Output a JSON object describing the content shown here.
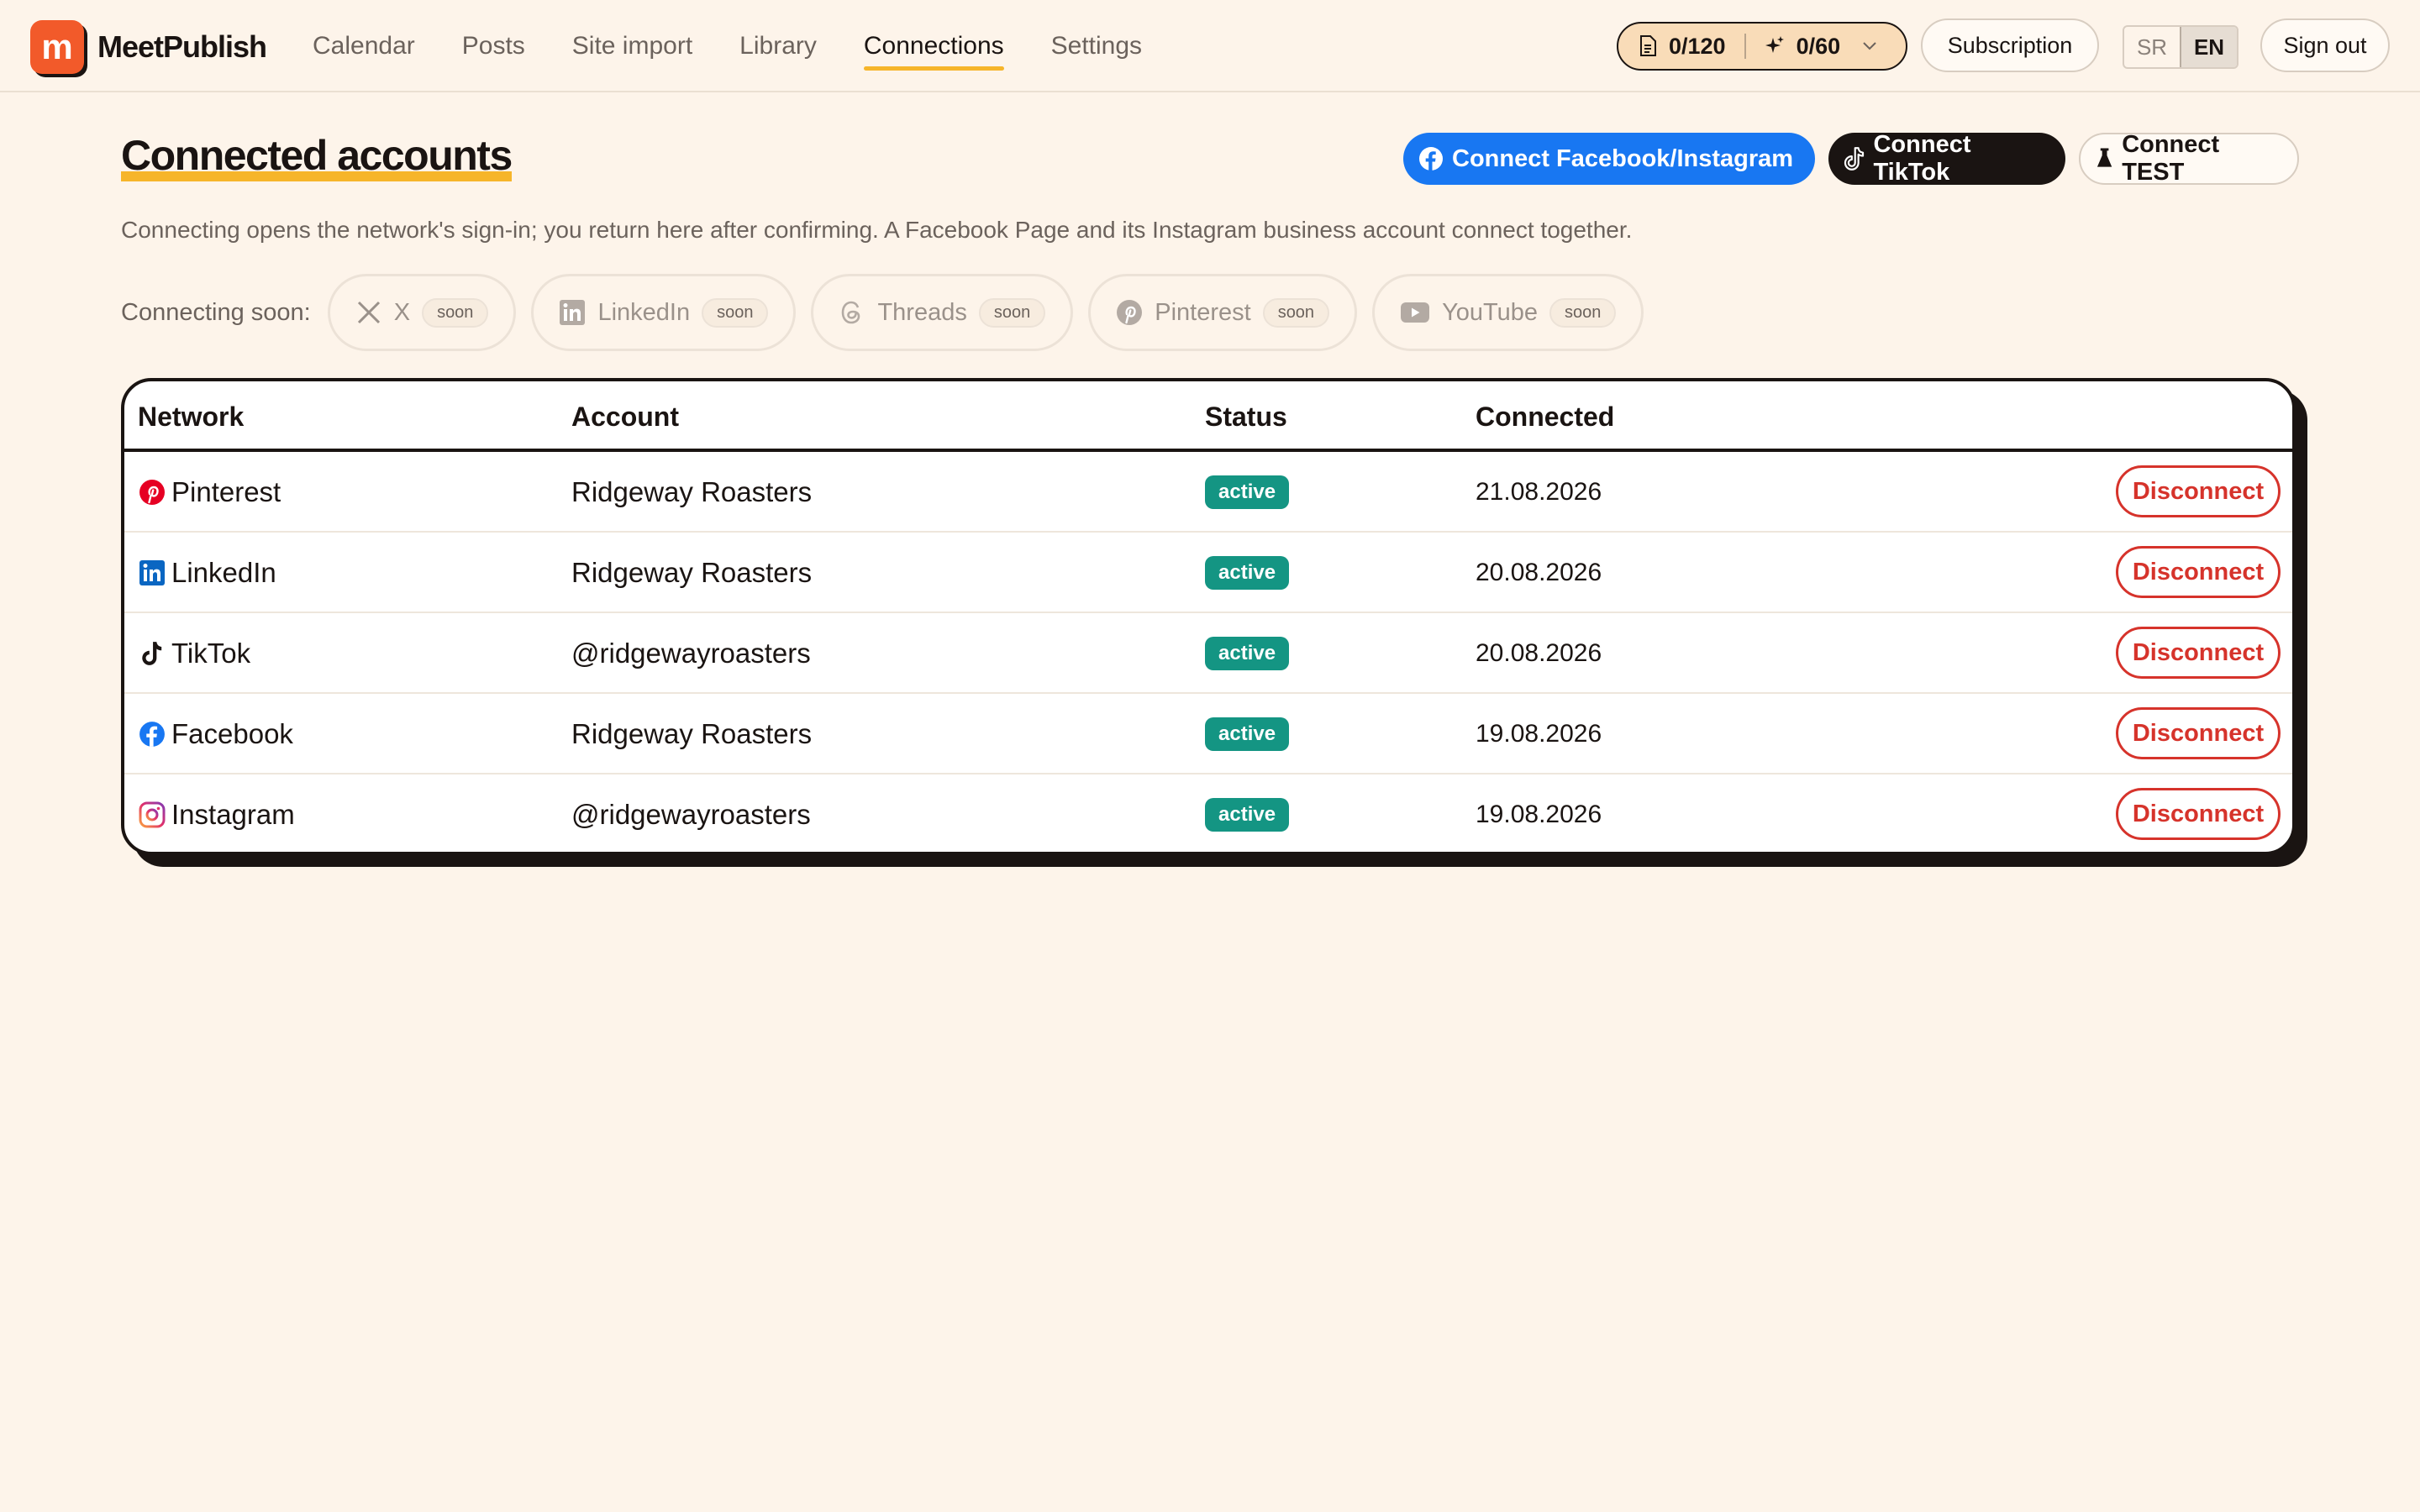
{
  "app": {
    "logo_letter": "m",
    "name": "MeetPublish"
  },
  "nav": [
    {
      "label": "Calendar",
      "active": false
    },
    {
      "label": "Posts",
      "active": false
    },
    {
      "label": "Site import",
      "active": false
    },
    {
      "label": "Library",
      "active": false
    },
    {
      "label": "Connections",
      "active": true
    },
    {
      "label": "Settings",
      "active": false
    }
  ],
  "quota": {
    "posts": "0/120",
    "ai": "0/60"
  },
  "header": {
    "subscription_label": "Subscription",
    "lang_sr": "SR",
    "lang_en": "EN",
    "lang_selected": "EN",
    "signout_label": "Sign out"
  },
  "page": {
    "title": "Connected accounts",
    "subtitle": "Connecting opens the network's sign-in; you return here after confirming. A Facebook Page and its Instagram business account connect together.",
    "connect_fb_label": "Connect Facebook/Instagram",
    "connect_tiktok_label": "Connect TikTok",
    "connect_test_label": "Connect TEST"
  },
  "soon": {
    "label": "Connecting soon:",
    "badge": "soon",
    "items": [
      "X",
      "LinkedIn",
      "Threads",
      "Pinterest",
      "YouTube"
    ]
  },
  "table": {
    "headers": {
      "network": "Network",
      "account": "Account",
      "status": "Status",
      "connected": "Connected"
    },
    "action_label": "Disconnect",
    "rows": [
      {
        "network": "Pinterest",
        "icon": "pinterest-icon",
        "account": "Ridgeway Roasters",
        "status": "active",
        "connected": "21.08.2026"
      },
      {
        "network": "LinkedIn",
        "icon": "linkedin-icon",
        "account": "Ridgeway Roasters",
        "status": "active",
        "connected": "20.08.2026"
      },
      {
        "network": "TikTok",
        "icon": "tiktok-icon",
        "account": "@ridgewayroasters",
        "status": "active",
        "connected": "20.08.2026"
      },
      {
        "network": "Facebook",
        "icon": "facebook-icon",
        "account": "Ridgeway Roasters",
        "status": "active",
        "connected": "19.08.2026"
      },
      {
        "network": "Instagram",
        "icon": "instagram-icon",
        "account": "@ridgewayroasters",
        "status": "active",
        "connected": "19.08.2026"
      }
    ]
  },
  "colors": {
    "background": "#fdf4ea",
    "brand": "#f25a2a",
    "accent_underline": "#f6b52a",
    "facebook": "#1877f2",
    "status_active": "#149583",
    "danger": "#d6332b"
  }
}
